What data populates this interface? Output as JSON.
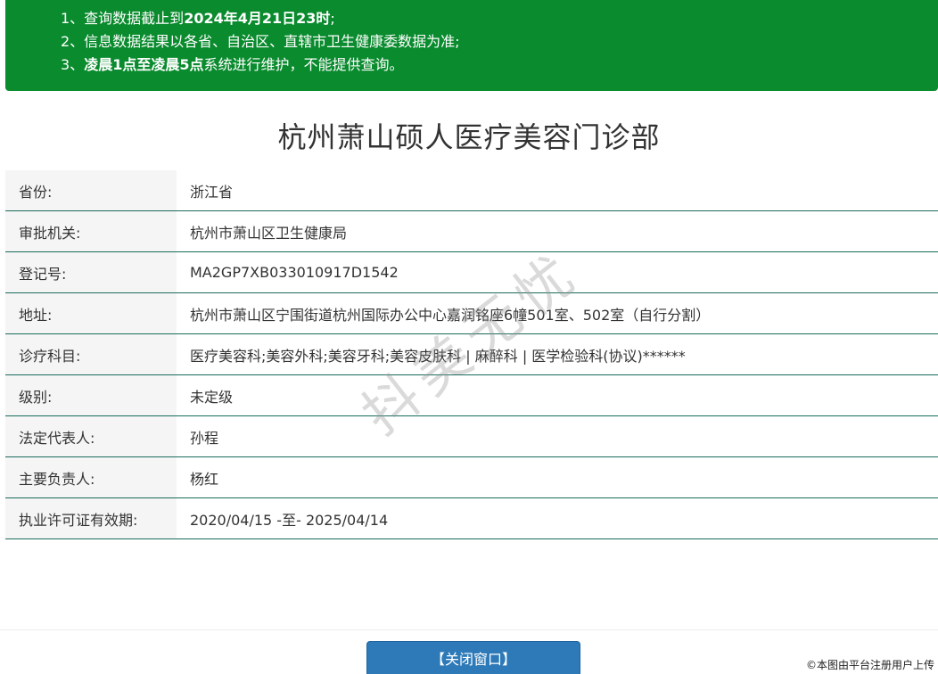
{
  "notice": {
    "line1_pre": "1、查询数据截止到",
    "line1_bold": "2024年4月21日23时",
    "line1_post": ";",
    "line2": "2、信息数据结果以各省、自治区、直辖市卫生健康委数据为准;",
    "line3_pre": "3、",
    "line3_bold": "凌晨1点至凌晨5点",
    "line3_post": "系统进行维护，不能提供查询。"
  },
  "title": "杭州萧山硕人医疗美容门诊部",
  "rows": [
    {
      "label": "省份:",
      "value": "浙江省"
    },
    {
      "label": "审批机关:",
      "value": "杭州市萧山区卫生健康局"
    },
    {
      "label": "登记号:",
      "value": "MA2GP7XB033010917D1542"
    },
    {
      "label": "地址:",
      "value": "杭州市萧山区宁围街道杭州国际办公中心嘉润铭座6幢501室、502室（自行分割）"
    },
    {
      "label": "诊疗科目:",
      "value": "医疗美容科;美容外科;美容牙科;美容皮肤科 | 麻醉科 | 医学检验科(协议)******"
    },
    {
      "label": "级别:",
      "value": "未定级"
    },
    {
      "label": "法定代表人:",
      "value": "孙程"
    },
    {
      "label": "主要负责人:",
      "value": "杨红"
    },
    {
      "label": "执业许可证有效期:",
      "value": "2020/04/15 -至- 2025/04/14"
    }
  ],
  "close_button": "【关闭窗口】",
  "watermark": "抖美无忧",
  "corner_note": "©本图由平台注册用户上传",
  "colors": {
    "notice_bg": "#0a8b2e",
    "row_border": "#1a6b5a",
    "button_bg": "#2e7ab8"
  }
}
